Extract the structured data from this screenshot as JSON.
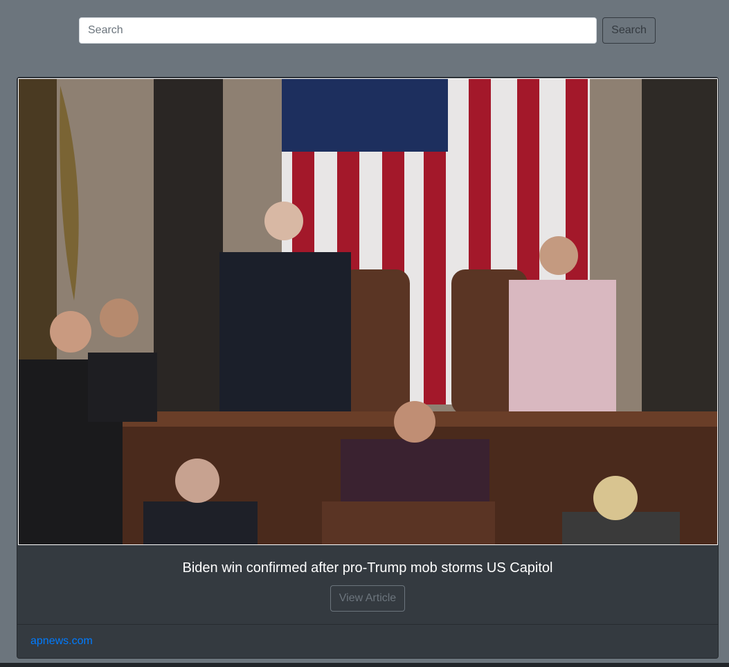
{
  "search": {
    "placeholder": "Search",
    "button_label": "Search"
  },
  "article": {
    "image_alt": "Photo of the US House chamber during certification, with officials standing at the rostrum before the American flag",
    "title": "Biden win confirmed after pro-Trump mob storms US Capitol",
    "view_label": "View Article",
    "source": "apnews.com"
  },
  "colors": {
    "page_bg": "#6c757d",
    "card_bg": "#343a40",
    "link": "#007bff"
  }
}
